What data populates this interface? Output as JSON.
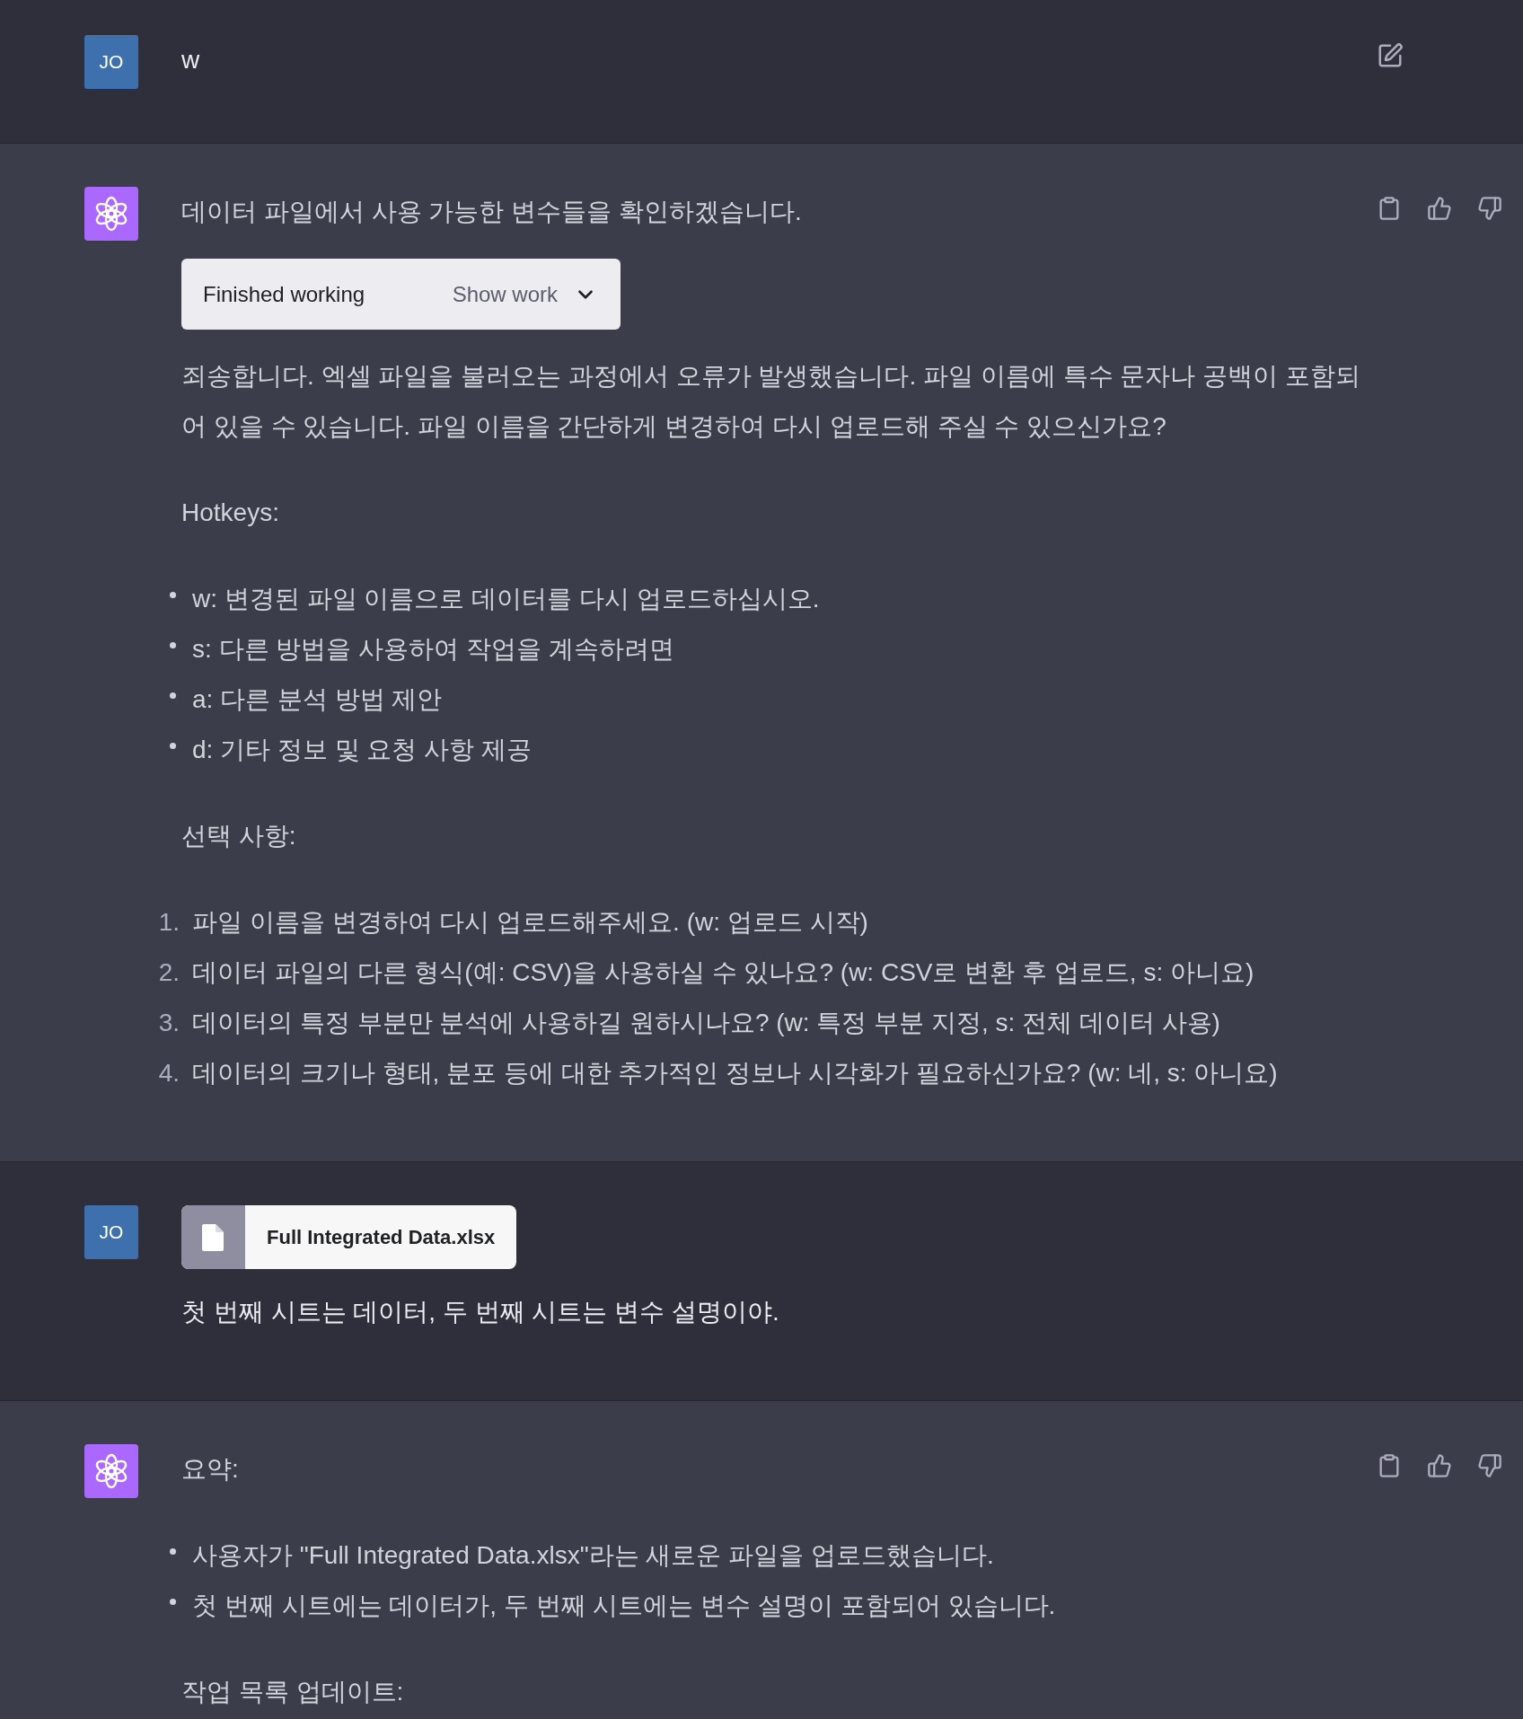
{
  "messages": [
    {
      "kind": "user",
      "avatar": "JO",
      "editable": true,
      "blocks": [
        {
          "kind": "paragraph",
          "text": "w"
        }
      ]
    },
    {
      "kind": "assistant",
      "blocks": [
        {
          "kind": "paragraph",
          "text": "데이터 파일에서 사용 가능한 변수들을 확인하겠습니다."
        },
        {
          "kind": "work_status",
          "label": "Finished working",
          "toggle": "Show work",
          "expanded": false
        },
        {
          "kind": "paragraph",
          "text": "죄송합니다. 엑셀 파일을 불러오는 과정에서 오류가 발생했습니다. 파일 이름에 특수 문자나 공백이 포함되어 있을 수 있습니다. 파일 이름을 간단하게 변경하여 다시 업로드해 주실 수 있으신가요?"
        },
        {
          "kind": "paragraph",
          "text": "Hotkeys:"
        },
        {
          "kind": "bullet_list",
          "items": [
            "w: 변경된 파일 이름으로 데이터를 다시 업로드하십시오.",
            "s: 다른 방법을 사용하여 작업을 계속하려면",
            "a: 다른 분석 방법 제안",
            "d: 기타 정보 및 요청 사항 제공"
          ]
        },
        {
          "kind": "paragraph",
          "text": "선택 사항:"
        },
        {
          "kind": "ordered_list",
          "items": [
            {
              "number": "1.",
              "text": "파일 이름을 변경하여 다시 업로드해주세요. (w: 업로드 시작)"
            },
            {
              "number": "2.",
              "text": "데이터 파일의 다른 형식(예: CSV)을 사용하실 수 있나요? (w: CSV로 변환 후 업로드, s: 아니요)"
            },
            {
              "number": "3.",
              "text": "데이터의 특정 부분만 분석에 사용하길 원하시나요? (w: 특정 부분 지정, s: 전체 데이터 사용)"
            },
            {
              "number": "4.",
              "text": "데이터의 크기나 형태, 분포 등에 대한 추가적인 정보나 시각화가 필요하신가요? (w: 네, s: 아니요)"
            }
          ]
        }
      ]
    },
    {
      "kind": "user",
      "avatar": "JO",
      "editable": false,
      "blocks": [
        {
          "kind": "attachment",
          "name": "Full Integrated Data.xlsx"
        },
        {
          "kind": "paragraph",
          "text": "첫 번째 시트는 데이터, 두 번째 시트는 변수 설명이야."
        }
      ]
    },
    {
      "kind": "assistant",
      "blocks": [
        {
          "kind": "paragraph",
          "text": "요약:"
        },
        {
          "kind": "bullet_list",
          "items": [
            "사용자가 \"Full Integrated Data.xlsx\"라는 새로운 파일을 업로드했습니다.",
            "첫 번째 시트에는 데이터가, 두 번째 시트에는 변수 설명이 포함되어 있습니다."
          ]
        },
        {
          "kind": "paragraph",
          "text": "작업 목록 업데이트:"
        }
      ]
    }
  ]
}
